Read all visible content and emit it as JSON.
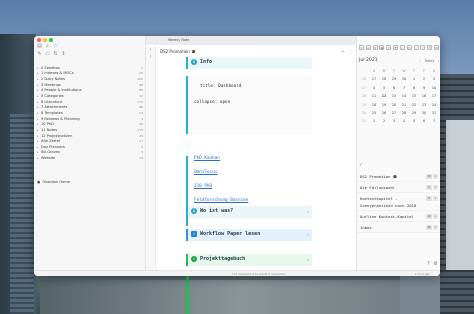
{
  "editor": {
    "tab_label": "Weekly Note",
    "doc_title": "DS2 Promotion 🎓",
    "callouts": {
      "info": "Info",
      "was_ist_was": "Wo ist was?",
      "workflow": "Workflow Paper lesen",
      "projekttagebuch": "Projekttagebuch"
    },
    "code_lines": [
      "title: Dashboard",
      "collapse: open"
    ],
    "links": [
      "PhD Kanban",
      "OmniFocus",
      "210 PhD",
      "Feldforschung Bosnien",
      "Interviews Bosnien"
    ]
  },
  "sidebar": {
    "items": [
      {
        "label": "0 Seedbox",
        "count": "7"
      },
      {
        "label": "1 Indexes & MOCs",
        "count": "29"
      },
      {
        "label": "2 Daily Notes",
        "count": "365"
      },
      {
        "label": "3 Meetings",
        "count": "89"
      },
      {
        "label": "4 People & Institutions",
        "count": "85"
      },
      {
        "label": "5 Categories",
        "count": "32"
      },
      {
        "label": "6 Literature",
        "count": "175"
      },
      {
        "label": "7 Attachments",
        "count": "96"
      },
      {
        "label": "8 Templates",
        "count": "23"
      },
      {
        "label": "9 Reviews & Planning",
        "count": "4"
      },
      {
        "label": "10 PhD",
        "count": "56"
      },
      {
        "label": "11 Notes",
        "count": "115"
      },
      {
        "label": "12 Projektnotizen",
        "count": "45"
      },
      {
        "label": "Alte Zettel",
        "count": "17"
      },
      {
        "label": "Day Planners",
        "count": "5"
      },
      {
        "label": "INI-Graves",
        "count": "3"
      },
      {
        "label": "Website",
        "count": "13"
      }
    ],
    "vault_name": "Obsidian Home"
  },
  "calendar": {
    "month": "Jul 2021",
    "today_label": "Today",
    "weekdays": [
      "",
      "S",
      "M",
      "T",
      "W",
      "T",
      "F",
      "S"
    ],
    "rows": [
      [
        "26",
        "27",
        "28",
        "29",
        "30",
        "1",
        "2",
        "3"
      ],
      [
        "27",
        "4",
        "5",
        "6",
        "7",
        "8",
        "9",
        "10"
      ],
      [
        "28",
        "11",
        "12",
        "13",
        "14",
        "15",
        "16",
        "17"
      ],
      [
        "29",
        "18",
        "19",
        "20",
        "21",
        "22",
        "23",
        "24"
      ],
      [
        "30",
        "25",
        "26",
        "27",
        "28",
        "29",
        "30",
        "31"
      ],
      [
        "31",
        "1",
        "2",
        "3",
        "4",
        "5",
        "6",
        "7"
      ]
    ]
  },
  "tasks": [
    {
      "label": "DS2 Promotion 🎓",
      "count": "16"
    },
    {
      "label": "Die Fallauswahl",
      "count": "6"
    },
    {
      "label": "Kontextkapitel - Szenypraktiken nach 2010",
      "count": "8"
    },
    {
      "label": "Outline Kontext-Kapitel",
      "count": "12"
    },
    {
      "label": "Inbox",
      "count": "26"
    }
  ],
  "status": {
    "left": "107 backlinks  6.1k words  9 characters",
    "right": "1 hour ago"
  }
}
